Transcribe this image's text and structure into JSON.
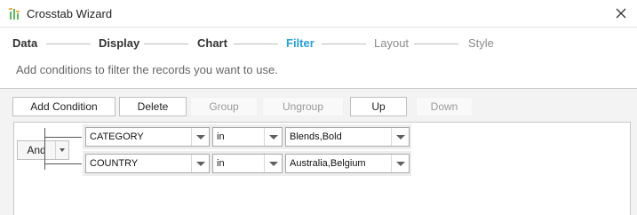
{
  "window": {
    "title": "Crosstab Wizard",
    "icon": "crosstab-icon",
    "close_icon": "close-icon"
  },
  "steps": [
    {
      "label": "Data",
      "state": "done"
    },
    {
      "label": "Display",
      "state": "done"
    },
    {
      "label": "Chart",
      "state": "done"
    },
    {
      "label": "Filter",
      "state": "active"
    },
    {
      "label": "Layout",
      "state": "todo"
    },
    {
      "label": "Style",
      "state": "todo"
    }
  ],
  "hint": "Add conditions to filter the records you want to use.",
  "toolbar": {
    "add_condition": "Add Condition",
    "delete": "Delete",
    "group": "Group",
    "ungroup": "Ungroup",
    "up": "Up",
    "down": "Down"
  },
  "logic": {
    "value": "And"
  },
  "conditions": [
    {
      "field": "CATEGORY",
      "operator": "in",
      "value": "Blends,Bold"
    },
    {
      "field": "COUNTRY",
      "operator": "in",
      "value": "Australia,Belgium"
    }
  ],
  "colors": {
    "active_step": "#2a9fd8",
    "panel_bg": "#f3f3f3"
  }
}
